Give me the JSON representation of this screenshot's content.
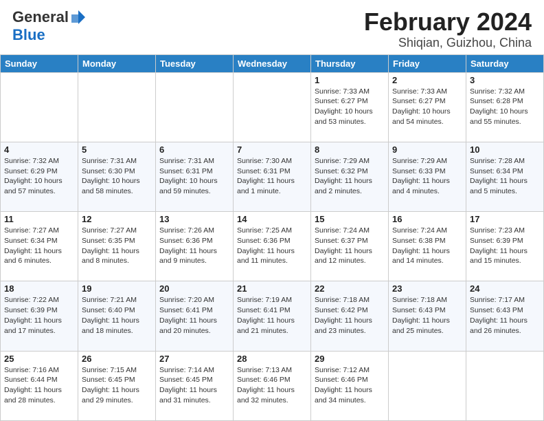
{
  "header": {
    "logo_general": "General",
    "logo_blue": "Blue",
    "month_year": "February 2024",
    "location": "Shiqian, Guizhou, China"
  },
  "weekdays": [
    "Sunday",
    "Monday",
    "Tuesday",
    "Wednesday",
    "Thursday",
    "Friday",
    "Saturday"
  ],
  "weeks": [
    [
      {
        "day": "",
        "info": ""
      },
      {
        "day": "",
        "info": ""
      },
      {
        "day": "",
        "info": ""
      },
      {
        "day": "",
        "info": ""
      },
      {
        "day": "1",
        "info": "Sunrise: 7:33 AM\nSunset: 6:27 PM\nDaylight: 10 hours\nand 53 minutes."
      },
      {
        "day": "2",
        "info": "Sunrise: 7:33 AM\nSunset: 6:27 PM\nDaylight: 10 hours\nand 54 minutes."
      },
      {
        "day": "3",
        "info": "Sunrise: 7:32 AM\nSunset: 6:28 PM\nDaylight: 10 hours\nand 55 minutes."
      }
    ],
    [
      {
        "day": "4",
        "info": "Sunrise: 7:32 AM\nSunset: 6:29 PM\nDaylight: 10 hours\nand 57 minutes."
      },
      {
        "day": "5",
        "info": "Sunrise: 7:31 AM\nSunset: 6:30 PM\nDaylight: 10 hours\nand 58 minutes."
      },
      {
        "day": "6",
        "info": "Sunrise: 7:31 AM\nSunset: 6:31 PM\nDaylight: 10 hours\nand 59 minutes."
      },
      {
        "day": "7",
        "info": "Sunrise: 7:30 AM\nSunset: 6:31 PM\nDaylight: 11 hours\nand 1 minute."
      },
      {
        "day": "8",
        "info": "Sunrise: 7:29 AM\nSunset: 6:32 PM\nDaylight: 11 hours\nand 2 minutes."
      },
      {
        "day": "9",
        "info": "Sunrise: 7:29 AM\nSunset: 6:33 PM\nDaylight: 11 hours\nand 4 minutes."
      },
      {
        "day": "10",
        "info": "Sunrise: 7:28 AM\nSunset: 6:34 PM\nDaylight: 11 hours\nand 5 minutes."
      }
    ],
    [
      {
        "day": "11",
        "info": "Sunrise: 7:27 AM\nSunset: 6:34 PM\nDaylight: 11 hours\nand 6 minutes."
      },
      {
        "day": "12",
        "info": "Sunrise: 7:27 AM\nSunset: 6:35 PM\nDaylight: 11 hours\nand 8 minutes."
      },
      {
        "day": "13",
        "info": "Sunrise: 7:26 AM\nSunset: 6:36 PM\nDaylight: 11 hours\nand 9 minutes."
      },
      {
        "day": "14",
        "info": "Sunrise: 7:25 AM\nSunset: 6:36 PM\nDaylight: 11 hours\nand 11 minutes."
      },
      {
        "day": "15",
        "info": "Sunrise: 7:24 AM\nSunset: 6:37 PM\nDaylight: 11 hours\nand 12 minutes."
      },
      {
        "day": "16",
        "info": "Sunrise: 7:24 AM\nSunset: 6:38 PM\nDaylight: 11 hours\nand 14 minutes."
      },
      {
        "day": "17",
        "info": "Sunrise: 7:23 AM\nSunset: 6:39 PM\nDaylight: 11 hours\nand 15 minutes."
      }
    ],
    [
      {
        "day": "18",
        "info": "Sunrise: 7:22 AM\nSunset: 6:39 PM\nDaylight: 11 hours\nand 17 minutes."
      },
      {
        "day": "19",
        "info": "Sunrise: 7:21 AM\nSunset: 6:40 PM\nDaylight: 11 hours\nand 18 minutes."
      },
      {
        "day": "20",
        "info": "Sunrise: 7:20 AM\nSunset: 6:41 PM\nDaylight: 11 hours\nand 20 minutes."
      },
      {
        "day": "21",
        "info": "Sunrise: 7:19 AM\nSunset: 6:41 PM\nDaylight: 11 hours\nand 21 minutes."
      },
      {
        "day": "22",
        "info": "Sunrise: 7:18 AM\nSunset: 6:42 PM\nDaylight: 11 hours\nand 23 minutes."
      },
      {
        "day": "23",
        "info": "Sunrise: 7:18 AM\nSunset: 6:43 PM\nDaylight: 11 hours\nand 25 minutes."
      },
      {
        "day": "24",
        "info": "Sunrise: 7:17 AM\nSunset: 6:43 PM\nDaylight: 11 hours\nand 26 minutes."
      }
    ],
    [
      {
        "day": "25",
        "info": "Sunrise: 7:16 AM\nSunset: 6:44 PM\nDaylight: 11 hours\nand 28 minutes."
      },
      {
        "day": "26",
        "info": "Sunrise: 7:15 AM\nSunset: 6:45 PM\nDaylight: 11 hours\nand 29 minutes."
      },
      {
        "day": "27",
        "info": "Sunrise: 7:14 AM\nSunset: 6:45 PM\nDaylight: 11 hours\nand 31 minutes."
      },
      {
        "day": "28",
        "info": "Sunrise: 7:13 AM\nSunset: 6:46 PM\nDaylight: 11 hours\nand 32 minutes."
      },
      {
        "day": "29",
        "info": "Sunrise: 7:12 AM\nSunset: 6:46 PM\nDaylight: 11 hours\nand 34 minutes."
      },
      {
        "day": "",
        "info": ""
      },
      {
        "day": "",
        "info": ""
      }
    ]
  ]
}
